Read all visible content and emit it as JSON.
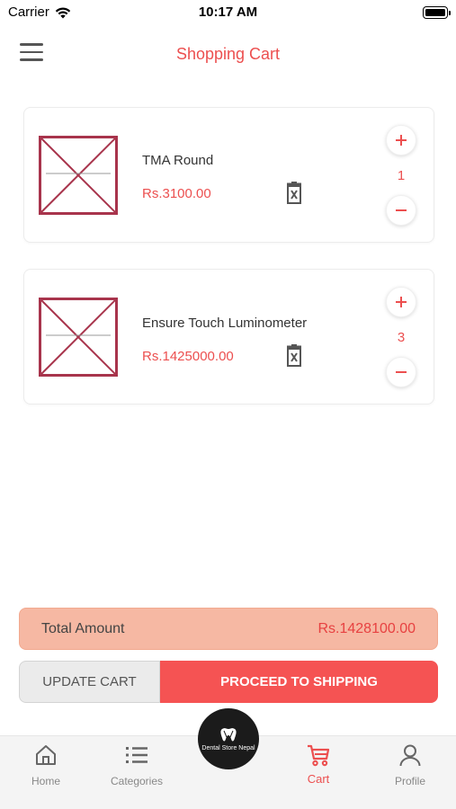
{
  "status_bar": {
    "carrier": "Carrier",
    "time": "10:17 AM"
  },
  "header": {
    "title": "Shopping Cart",
    "menu_icon": "hamburger-menu-icon"
  },
  "cart": {
    "items": [
      {
        "name": "TMA Round",
        "price": "Rs.3100.00",
        "quantity": "1"
      },
      {
        "name": "Ensure Touch Luminometer",
        "price": "Rs.1425000.00",
        "quantity": "3"
      }
    ]
  },
  "total": {
    "label": "Total Amount",
    "value": "Rs.1428100.00"
  },
  "actions": {
    "update_label": "UPDATE CART",
    "proceed_label": "PROCEED TO SHIPPING"
  },
  "bottom_nav": {
    "items": [
      {
        "label": "Home",
        "icon": "home-icon"
      },
      {
        "label": "Categories",
        "icon": "list-icon"
      },
      {
        "label": "Cart",
        "icon": "cart-icon",
        "active": true
      },
      {
        "label": "Profile",
        "icon": "user-icon"
      }
    ],
    "logo_text": "Dental Store Nepal"
  },
  "colors": {
    "accent": "#ec4f4f",
    "proceed_bg": "#f55353",
    "total_bg": "#f6b8a3",
    "update_bg": "#ebebeb",
    "nav_bg": "#f4f4f4"
  }
}
